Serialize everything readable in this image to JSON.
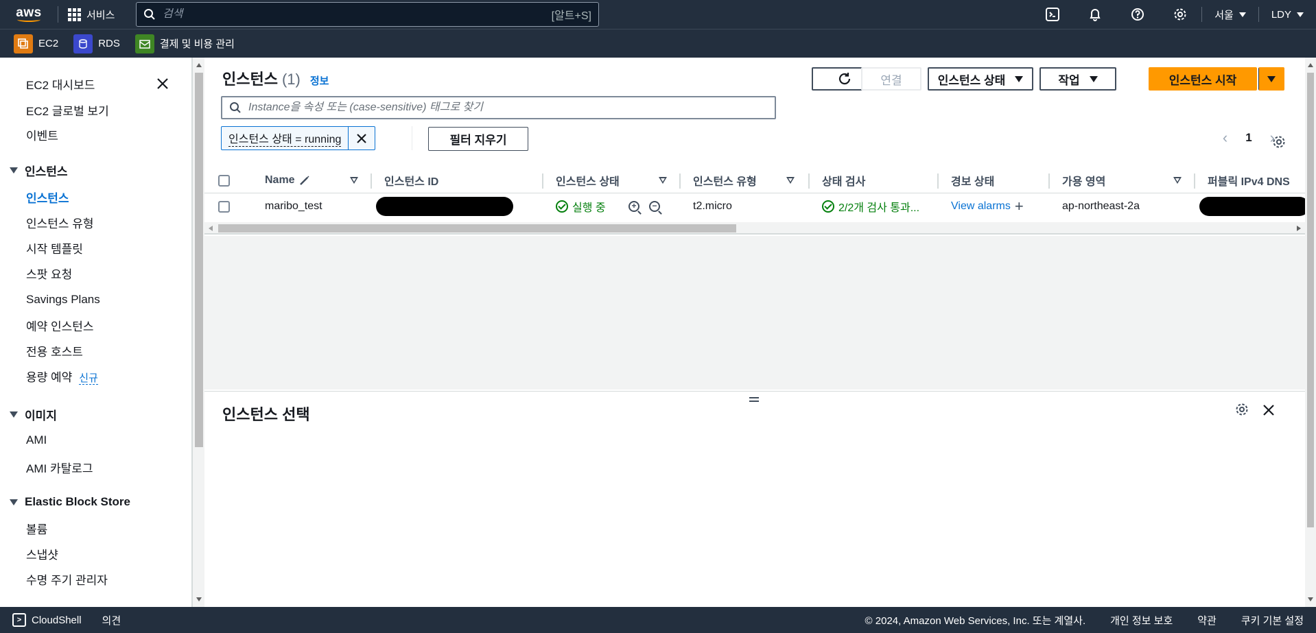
{
  "topnav": {
    "logo": "aws",
    "services_label": "서비스",
    "search_placeholder": "검색",
    "search_shortcut": "[알트+S]",
    "region": "서울",
    "user": "LDY"
  },
  "favorites": [
    {
      "label": "EC2",
      "icon": "ec2-icon",
      "color": "#e07b12"
    },
    {
      "label": "RDS",
      "icon": "rds-icon",
      "color": "#3b48cc"
    },
    {
      "label": "결제 및 비용 관리",
      "icon": "billing-icon",
      "color": "#3f8624"
    }
  ],
  "sidebar": {
    "top_links": [
      "EC2 대시보드",
      "EC2 글로벌 보기",
      "이벤트"
    ],
    "sections": [
      {
        "title": "인스턴스",
        "items": [
          "인스턴스",
          "인스턴스 유형",
          "시작 템플릿",
          "스팟 요청",
          "Savings Plans",
          "예약 인스턴스",
          "전용 호스트",
          "용량 예약"
        ],
        "active": "인스턴스"
      },
      {
        "title": "이미지",
        "items": [
          "AMI",
          "AMI 카탈로그"
        ]
      },
      {
        "title": "Elastic Block Store",
        "items": [
          "볼륨",
          "스냅샷",
          "수명 주기 관리자"
        ]
      }
    ],
    "new_badge": "신규"
  },
  "main": {
    "title": "인스턴스",
    "count": "(1)",
    "info_link": "정보",
    "buttons": {
      "connect": "연결",
      "instance_state": "인스턴스 상태",
      "actions": "작업",
      "launch": "인스턴스 시작"
    },
    "filter_placeholder": "Instance을 속성 또는 (case-sensitive) 태그로 찾기",
    "token": "인스턴스 상태 = running",
    "clear_filters": "필터 지우기",
    "page": "1",
    "columns": [
      "Name",
      "인스턴스 ID",
      "인스턴스 상태",
      "인스턴스 유형",
      "상태 검사",
      "경보 상태",
      "가용 영역",
      "퍼블릭 IPv4 DNS"
    ],
    "rows": [
      {
        "name": "maribo_test",
        "state": "실행 중",
        "type": "t2.micro",
        "status_check": "2/2개 검사 통과...",
        "alarm": "View alarms",
        "az": "ap-northeast-2a"
      }
    ],
    "detail_title": "인스턴스 선택"
  },
  "footer": {
    "cloudshell": "CloudShell",
    "feedback": "의견",
    "copyright": "© 2024, Amazon Web Services, Inc. 또는 계열사.",
    "privacy": "개인 정보 보호",
    "terms": "약관",
    "cookies": "쿠키 기본 설정"
  }
}
